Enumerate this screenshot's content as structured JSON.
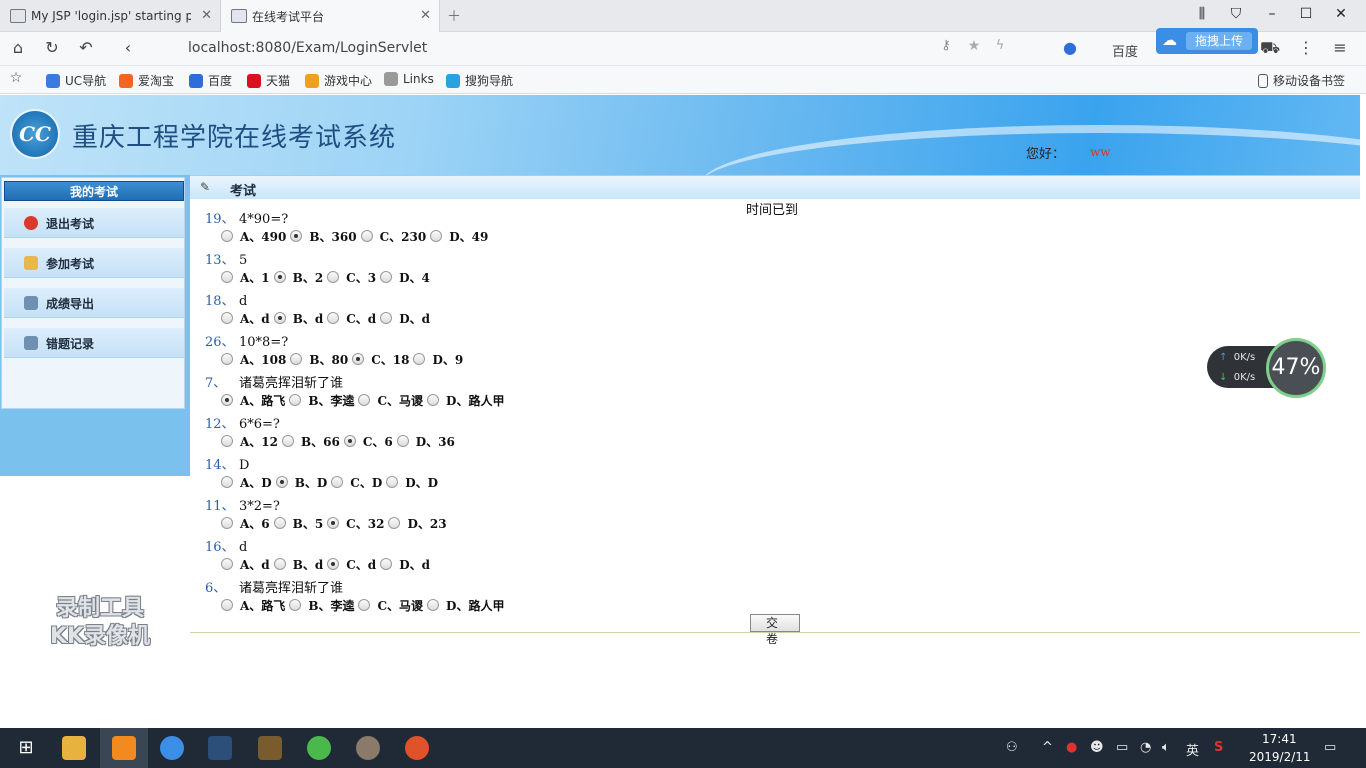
{
  "tabs": [
    {
      "title": "My JSP 'login.jsp' starting p",
      "active": false
    },
    {
      "title": "在线考试平台",
      "active": true
    }
  ],
  "nav": {
    "url": "localhost:8080/Exam/LoginServlet",
    "search_engine": "百度",
    "upload_label": "拖拽上传"
  },
  "bookmarks": [
    {
      "label": "UC导航",
      "icon": "uc-nav-icon",
      "color": "#3b7be0"
    },
    {
      "label": "爱淘宝",
      "icon": "taobao-icon",
      "color": "#f26522"
    },
    {
      "label": "百度",
      "icon": "baidu-paw-icon",
      "color": "#2f6ed9"
    },
    {
      "label": "天猫",
      "icon": "tmall-icon",
      "color": "#d8121f"
    },
    {
      "label": "游戏中心",
      "icon": "game-center-icon",
      "color": "#f0a020"
    },
    {
      "label": "Links",
      "icon": "folder-icon",
      "color": "#9a9a9a"
    },
    {
      "label": "搜狗导航",
      "icon": "sogou-icon",
      "color": "#29a3e0"
    }
  ],
  "mobile_bookmark": "移动设备书签",
  "site": {
    "logo_text": "CC",
    "title": "重庆工程学院在线考试系统",
    "greeting": "您好：",
    "username": "ww"
  },
  "sidebar": {
    "header": "我的考试",
    "items": [
      {
        "label": "退出考试",
        "icon": "exit-icon",
        "color": "#d93a2b"
      },
      {
        "label": "参加考试",
        "icon": "notepad-icon",
        "color": "#e7b84b"
      },
      {
        "label": "成绩导出",
        "icon": "tools-icon",
        "color": "#6f8fb3"
      },
      {
        "label": "错题记录",
        "icon": "tools-icon",
        "color": "#6f8fb3"
      }
    ]
  },
  "content": {
    "title": "考试",
    "time_up": "时间已到",
    "submit_label": "交 卷"
  },
  "questions": [
    {
      "num": "19、",
      "text": "4*90=?",
      "options": [
        "A、490",
        "B、360",
        "C、230",
        "D、49"
      ],
      "selected": 1
    },
    {
      "num": "13、",
      "text": "5",
      "options": [
        "A、1",
        "B、2",
        "C、3",
        "D、4"
      ],
      "selected": 1
    },
    {
      "num": "18、",
      "text": "d",
      "options": [
        "A、d",
        "B、d",
        "C、d",
        "D、d"
      ],
      "selected": 1
    },
    {
      "num": "26、",
      "text": "10*8=?",
      "options": [
        "A、108",
        "B、80",
        "C、18",
        "D、9"
      ],
      "selected": 2
    },
    {
      "num": "7、",
      "text": "诸葛亮挥泪斩了谁",
      "options": [
        "A、路飞",
        "B、李逵",
        "C、马谡",
        "D、路人甲"
      ],
      "selected": 0
    },
    {
      "num": "12、",
      "text": "6*6=?",
      "options": [
        "A、12",
        "B、66",
        "C、6",
        "D、36"
      ],
      "selected": 2
    },
    {
      "num": "14、",
      "text": "D",
      "options": [
        "A、D",
        "B、D",
        "C、D",
        "D、D"
      ],
      "selected": 1
    },
    {
      "num": "11、",
      "text": "3*2=?",
      "options": [
        "A、6",
        "B、5",
        "C、32",
        "D、23"
      ],
      "selected": 2
    },
    {
      "num": "16、",
      "text": "d",
      "options": [
        "A、d",
        "B、d",
        "C、d",
        "D、d"
      ],
      "selected": 2
    },
    {
      "num": "6、",
      "text": "诸葛亮挥泪斩了谁",
      "options": [
        "A、路飞",
        "B、李逵",
        "C、马谡",
        "D、路人甲"
      ],
      "selected": -1
    }
  ],
  "watermark": [
    "录制工具",
    "KK录像机"
  ],
  "speed_widget": {
    "up": "0K/s",
    "down": "0K/s",
    "percent": "47%"
  },
  "taskbar": {
    "ime": "英",
    "time": "17:41",
    "date": "2019/2/11"
  }
}
